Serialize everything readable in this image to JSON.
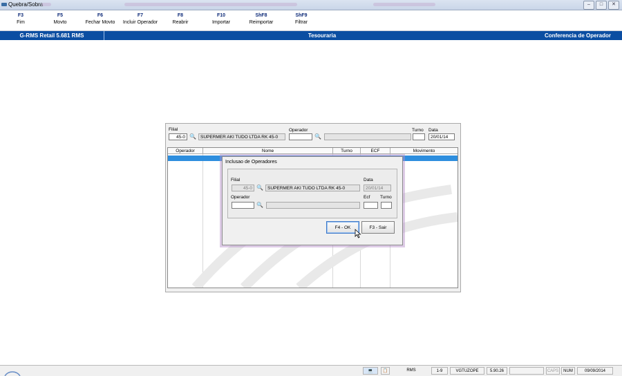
{
  "window": {
    "title": "Quebra/Sobra"
  },
  "fkeys": [
    {
      "key": "F3",
      "label": "Fim"
    },
    {
      "key": "F5",
      "label": "Movto"
    },
    {
      "key": "F6",
      "label": "Fechar Movto"
    },
    {
      "key": "F7",
      "label": "Incluir Operador"
    },
    {
      "key": "F8",
      "label": "Reabrir"
    },
    {
      "key": "F10",
      "label": "Importar"
    },
    {
      "key": "ShF8",
      "label": "Reimportar"
    },
    {
      "key": "ShF9",
      "label": "Filtrar"
    }
  ],
  "header": {
    "product": "G-RMS Retail 5.681 RMS",
    "module": "Tesouraria",
    "screen": "Conferencia de Operador"
  },
  "filters": {
    "filial_label": "Filial",
    "filial_value": "45-0",
    "filial_name": "SUPERMER AKI TUDO LTDA RK 45-0",
    "operador_label": "Operador",
    "operador_value": "",
    "operador_name": "",
    "turno_label": "Turno",
    "turno_value": "",
    "data_label": "Data",
    "data_value": "20/01/14"
  },
  "grid": {
    "columns": [
      "Operador",
      "Nome",
      "Turno",
      "ECF",
      "Movimento"
    ]
  },
  "dialog": {
    "title": "Inclusao de Operadores",
    "filial_label": "Filial",
    "filial_value": "45-0",
    "filial_name": "SUPERMER AKI TUDO LTDA RK 45-0",
    "data_label": "Data",
    "data_value": "20/01/14",
    "operador_label": "Operador",
    "operador_value": "",
    "operador_name": "",
    "ecf_label": "Ecf",
    "ecf_value": "",
    "turno_label": "Turno",
    "turno_value": "",
    "ok_label": "F4 - OK",
    "cancel_label": "F3 - Sair"
  },
  "statusbar": {
    "app": "RMS",
    "page": "1-9",
    "user": "VGTUZOPE",
    "version": "5.90.26",
    "caps": "CAPS",
    "num": "NUM",
    "date": "09/09/2014"
  },
  "colors": {
    "accent": "#0b4ea2",
    "selection": "#2e8ede"
  }
}
